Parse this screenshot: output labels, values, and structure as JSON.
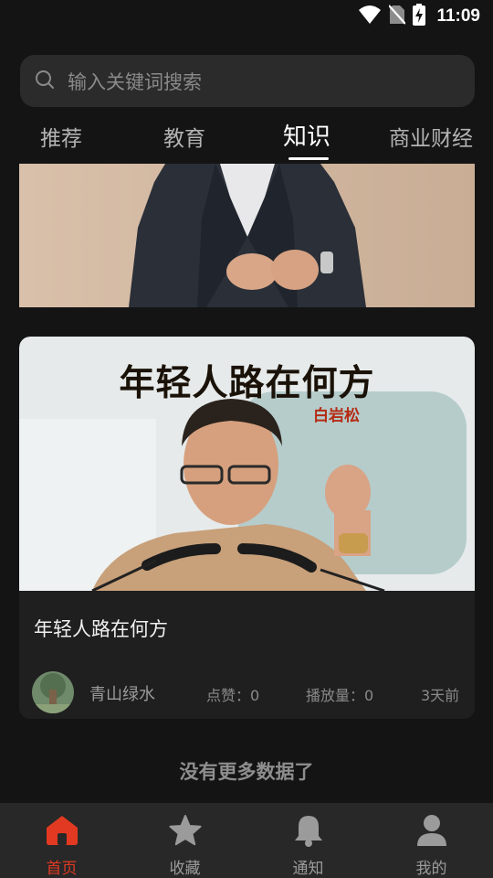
{
  "status_bar": {
    "time": "11:09",
    "icons": [
      "wifi-icon",
      "no-sim-icon",
      "battery-charging-icon"
    ]
  },
  "search": {
    "placeholder": "输入关键词搜索",
    "icon": "search-icon"
  },
  "tabs": [
    {
      "label": "推荐",
      "active": false
    },
    {
      "label": "教育",
      "active": false
    },
    {
      "label": "知识",
      "active": true
    },
    {
      "label": "商业财经",
      "active": false
    }
  ],
  "feed": {
    "video": {
      "thumbnail_title": "年轻人路在何方",
      "thumbnail_subtitle": "白岩松",
      "title": "年轻人路在何方",
      "author": "青山绿水",
      "likes": "点赞：0",
      "plays": "播放量：0",
      "time_ago": "3天前"
    },
    "end_text": "没有更多数据了"
  },
  "bottom_nav": [
    {
      "label": "首页",
      "icon": "home-icon",
      "active": true
    },
    {
      "label": "收藏",
      "icon": "star-icon",
      "active": false
    },
    {
      "label": "通知",
      "icon": "bell-icon",
      "active": false
    },
    {
      "label": "我的",
      "icon": "person-icon",
      "active": false
    }
  ],
  "colors": {
    "accent": "#e23a22",
    "background": "#141414",
    "card": "#1f1f1f",
    "nav": "#282828"
  }
}
